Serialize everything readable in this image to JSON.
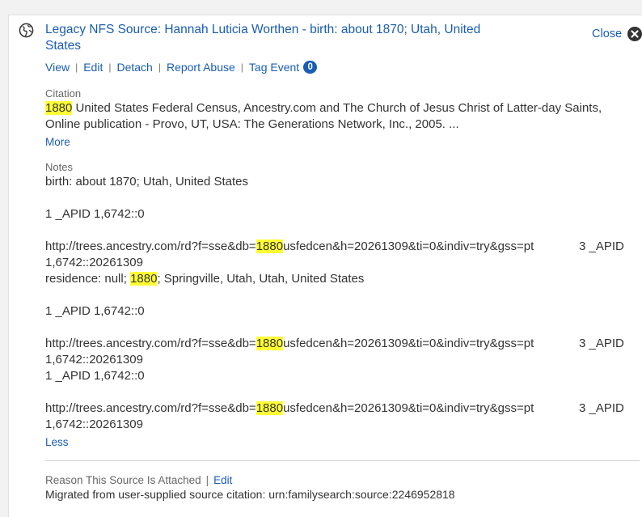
{
  "source": {
    "title": "Legacy NFS Source: Hannah Luticia Worthen - birth: about 1870; Utah, United States",
    "close_label": "Close"
  },
  "actions": [
    {
      "label": "View"
    },
    {
      "label": "Edit"
    },
    {
      "label": "Detach"
    },
    {
      "label": "Report Abuse"
    },
    {
      "label": "Tag Event"
    }
  ],
  "tag_count": "0",
  "citation": {
    "label": "Citation",
    "highlight": "1880",
    "text_line1": " United States Federal Census, Ancestry.com and The Church of Jesus Christ of Latter-day Saints,",
    "text_line2": "Online publication - Provo, UT, USA: The Generations Network, Inc., 2005.  ...",
    "more_label": "More"
  },
  "notes": {
    "label": "Notes",
    "line_birth": "birth: about 1870; Utah, United States",
    "apid_a": "1  _APID 1,6742::0",
    "url_prefix": "http://trees.ancestry.com/rd?f=sse&db=",
    "url_highlight": "1880",
    "url_suffix": "usfedcen&h=20261309&ti=0&indiv=try&gss=pt",
    "apid_right": "3  _APID",
    "apid_cont": "1,6742::20261309",
    "residence_prefix": "residence: null; ",
    "residence_highlight": "1880",
    "residence_suffix": "; Springville, Utah, Utah, United States",
    "less_label": "Less"
  },
  "reason": {
    "label": "Reason This Source Is Attached",
    "edit_label": "Edit",
    "migrated_text": "Migrated from user-supplied source citation: urn:familysearch:source:2246952818"
  },
  "colors": {
    "link": "#1a5db3",
    "highlight": "#ffff33"
  }
}
